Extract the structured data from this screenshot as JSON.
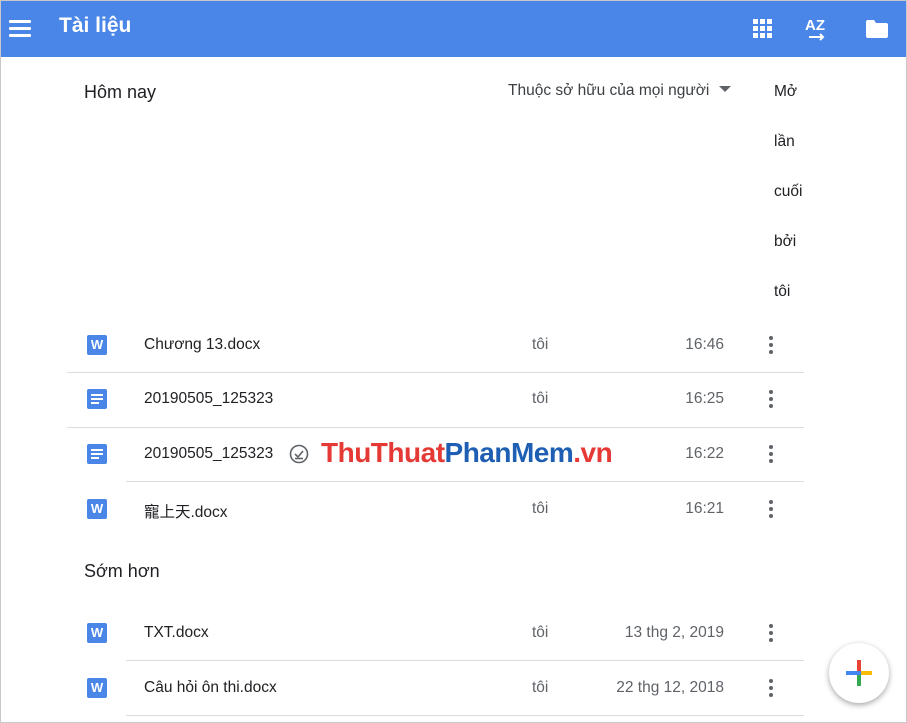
{
  "app": {
    "title": "Tài liệu"
  },
  "toolbar": {
    "sort_label": "AZ"
  },
  "today_section": {
    "title": "Hôm nay"
  },
  "owner_filter": {
    "label": "Thuộc sở hữu của mọi người"
  },
  "sort_column": {
    "words": [
      "Mở",
      "lần",
      "cuối",
      "bởi",
      "tôi"
    ]
  },
  "files_today": [
    {
      "name": "Chương 13.docx",
      "owner": "tôi",
      "date": "16:46",
      "icon": "word-doc-icon"
    },
    {
      "name": "20190505_125323",
      "owner": "tôi",
      "date": "16:25",
      "icon": "google-doc-icon"
    },
    {
      "name": "20190505_125323",
      "owner": "",
      "date": "16:22",
      "icon": "google-doc-icon"
    },
    {
      "name": "寵上天.docx",
      "owner": "tôi",
      "date": "16:21",
      "icon": "word-doc-icon"
    }
  ],
  "earlier_section": {
    "title": "Sớm hơn"
  },
  "files_earlier": [
    {
      "name": "TXT.docx",
      "owner": "tôi",
      "date": "13 thg 2, 2019",
      "icon": "word-doc-icon"
    },
    {
      "name": "Câu hỏi ôn thi.docx",
      "owner": "tôi",
      "date": "22 thg 12, 2018",
      "icon": "word-doc-icon"
    }
  ],
  "watermark": {
    "part1": "ThuThuat",
    "part2": "PhanMem",
    "part3": ".vn"
  },
  "colors": {
    "appbar": "#4a86e8",
    "doc_icon": "#4a86e8",
    "text": "#202124",
    "muted": "#5f6368"
  }
}
